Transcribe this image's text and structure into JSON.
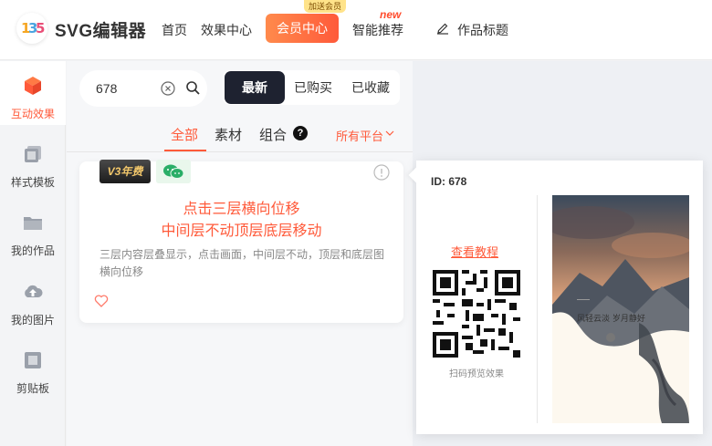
{
  "app": {
    "logo_text": "SVG编辑器",
    "logo_glyphs": [
      "1",
      "3",
      "5"
    ]
  },
  "nav": {
    "home": "首页",
    "effects_center": "效果中心",
    "vip_center": "会员中心",
    "vip_badge": "加送会员",
    "smart_recommend": "智能推荐",
    "new_badge": "new",
    "work_title": "作品标题"
  },
  "sidebar": {
    "items": [
      {
        "label": "互动效果",
        "icon": "cube-icon"
      },
      {
        "label": "样式模板",
        "icon": "template-icon"
      },
      {
        "label": "我的作品",
        "icon": "folder-icon"
      },
      {
        "label": "我的图片",
        "icon": "cloud-upload-icon"
      },
      {
        "label": "剪贴板",
        "icon": "clipboard-icon"
      }
    ]
  },
  "search": {
    "value": "678"
  },
  "sort_tabs": [
    "最新",
    "已购买",
    "已收藏"
  ],
  "filters": {
    "all": "全部",
    "material": "素材",
    "combo": "组合",
    "combo_help": "?",
    "platform": "所有平台"
  },
  "card": {
    "v3_badge": "V3年费",
    "title_line1": "点击三层横向位移",
    "title_line2": "中间层不动顶层底层移动",
    "description": "三层内容层叠显示，点击画面，中间层不动，顶层和底层图横向位移"
  },
  "preview": {
    "id_label": "ID: 678",
    "tutorial_link": "查看教程",
    "scan_hint": "扫码预览效果",
    "art_caption": "风轻云淡   岁月静好"
  },
  "colors": {
    "accent": "#ff5a3a",
    "dark": "#1e2230"
  }
}
